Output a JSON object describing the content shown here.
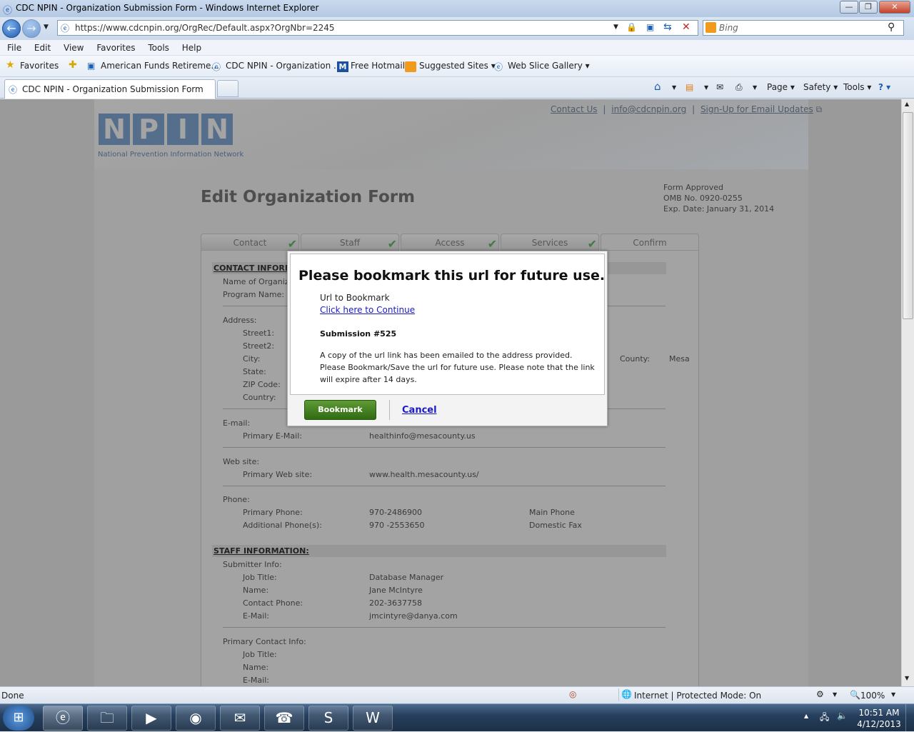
{
  "window": {
    "title": "CDC NPIN - Organization Submission Form - Windows Internet Explorer",
    "minimize": "—",
    "restore": "❐",
    "close": "✕"
  },
  "address": {
    "url": "https://www.cdcnpin.org/OrgRec/Default.aspx?OrgNbr=2245",
    "search_placeholder": "Bing"
  },
  "menu": [
    "File",
    "Edit",
    "View",
    "Favorites",
    "Tools",
    "Help"
  ],
  "favorites": {
    "label": "Favorites",
    "items": [
      "American Funds Retireme...",
      "CDC NPIN - Organization ...",
      "Free Hotmail",
      "Suggested Sites ▾",
      "Web Slice Gallery ▾"
    ]
  },
  "tab": {
    "title": "CDC NPIN - Organization Submission Form"
  },
  "command_bar": {
    "page": "Page ▾",
    "safety": "Safety ▾",
    "tools": "Tools ▾",
    "help": "? ▾"
  },
  "site": {
    "top_links": [
      "Contact Us",
      "info@cdcnpin.org",
      "Sign-Up for Email Updates"
    ],
    "logo_letters": [
      "N",
      "P",
      "I",
      "N"
    ],
    "logo_subtitle": "National Prevention Information Network",
    "page_title": "Edit Organization Form",
    "form_approved": [
      "Form Approved",
      "OMB No. 0920-0255",
      "Exp. Date: January 31, 2014"
    ],
    "tabs": [
      "Contact",
      "Staff",
      "Access",
      "Services",
      "Confirm"
    ],
    "check": "✔"
  },
  "form": {
    "contact_header": "CONTACT INFORMATION:",
    "name_label": "Name of Organization:",
    "program_label": "Program Name:",
    "address_label": "Address:",
    "street1": "Street1:",
    "street2": "Street2:",
    "city": "City:",
    "state": "State:",
    "zip": "ZIP Code:",
    "country": "Country:",
    "county_label": "County:",
    "county_value": "Mesa",
    "email_label": "E-mail:",
    "primary_email_label": "Primary E-Mail:",
    "primary_email": "healthinfo@mesacounty.us",
    "website_label": "Web site:",
    "primary_website_label": "Primary Web site:",
    "primary_website": "www.health.mesacounty.us/",
    "phone_label": "Phone:",
    "primary_phone_label": "Primary Phone:",
    "primary_phone": "970-2486900",
    "primary_phone_type": "Main Phone",
    "additional_phone_label": "Additional Phone(s):",
    "additional_phone": "970 -2553650",
    "additional_phone_type": "Domestic Fax",
    "staff_header": "STAFF INFORMATION:",
    "submitter_label": "Submitter Info:",
    "job_title_label": "Job Title:",
    "job_title": "Database Manager",
    "name_label2": "Name:",
    "name_value": "Jane McIntyre",
    "contact_phone_label": "Contact Phone:",
    "contact_phone": "202-3637758",
    "email_label2": "E-Mail:",
    "email_value": "jmcintyre@danya.com",
    "primary_contact_label": "Primary Contact Info:",
    "pc_job_title": "Job Title:",
    "pc_name": "Name:",
    "pc_email": "E-Mail:"
  },
  "modal": {
    "title": "Please bookmark this url for future use.",
    "url_label": "Url to Bookmark",
    "link": "Click here to Continue",
    "submission": "Submission #525",
    "message": "A copy of the url link has been emailed to the address provided. Please Bookmark/Save the url for future use. Please note that the link will expire after 14 days.",
    "bookmark_button": "Bookmark",
    "cancel": "Cancel"
  },
  "status": {
    "text": "Done",
    "zone": "Internet | Protected Mode: On",
    "zoom": "100%"
  },
  "taskbar": {
    "time": "10:51 AM",
    "date": "4/12/2013"
  }
}
